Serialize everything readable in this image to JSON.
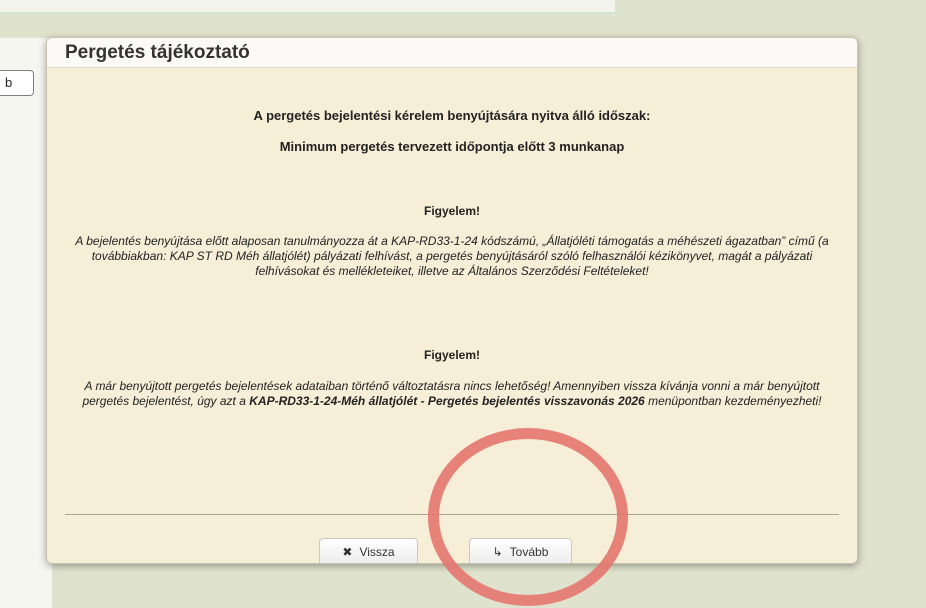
{
  "background": {
    "partial_button_label": "b"
  },
  "modal": {
    "title": "Pergetés tájékoztató",
    "period_heading": "A pergetés bejelentési kérelem benyújtására nyitva álló időszak:",
    "period_value": "Minimum pergetés tervezett időpontja előtt 3 munkanap",
    "warning1": {
      "title": "Figyelem!",
      "text": "A bejelentés benyújtása előtt alaposan tanulmányozza át a KAP-RD33-1-24 kódszámú, „Állatjóléti támogatás a méhészeti ágazatban” című (a továbbiakban: KAP ST RD Méh állatjólét) pályázati felhívást, a pergetés benyújtásáról szóló felhasználói kézikönyvet, magát a pályázati felhívásokat és mellékleteiket, illetve az Általános Szerződési Feltételeket!"
    },
    "warning2": {
      "title": "Figyelem!",
      "text_before": "A már benyújtott pergetés bejelentések adataiban történő változtatásra nincs lehetőség! Amennyiben vissza kívánja vonni a már benyújtott pergetés bejelentést, úgy azt a ",
      "text_bold": "KAP-RD33-1-24-Méh állatjólét - Pergetés bejelentés visszavonás 2026",
      "text_after": " menüpontban kezdeményezheti!"
    },
    "back_button": {
      "icon": "close-icon",
      "glyph": "✖",
      "label": "Vissza"
    },
    "next_button": {
      "icon": "forward-arrow-icon",
      "glyph": "↳",
      "label": "Tovább"
    }
  },
  "annotation": {
    "color": "#e4756f"
  }
}
